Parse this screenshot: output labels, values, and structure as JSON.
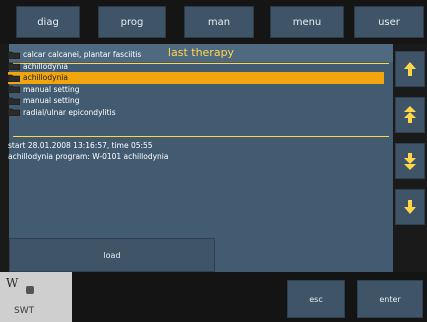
{
  "tabs": [
    "diag",
    "prog",
    "man",
    "menu",
    "user"
  ],
  "panel": {
    "title": "last therapy",
    "items": [
      {
        "label": "calcar calcanei, plantar fasciitis",
        "selected": false
      },
      {
        "label": "achillodynia",
        "selected": false
      },
      {
        "label": "achillodynia",
        "selected": true
      },
      {
        "label": "manual setting",
        "selected": false
      },
      {
        "label": "manual setting",
        "selected": false
      },
      {
        "label": "radial/ulnar epicondylitis",
        "selected": false
      }
    ],
    "info_line1": "start 28.01.2008 13:16:57, time 05:55",
    "info_line2": "achillodynia program: W-0101 achillodynia"
  },
  "buttons": {
    "load": "load",
    "esc": "esc",
    "enter": "enter"
  },
  "scroll_icons": [
    "arrow-up-icon",
    "double-arrow-up-icon",
    "double-arrow-down-icon",
    "arrow-down-icon"
  ],
  "brand": {
    "text1": "W",
    "text2": "SWT"
  },
  "colors": {
    "accent_yellow": "#ffd64a",
    "selection_orange": "#f2a60d",
    "panel_blue": "#425b70",
    "button_blue": "#3f5466"
  }
}
